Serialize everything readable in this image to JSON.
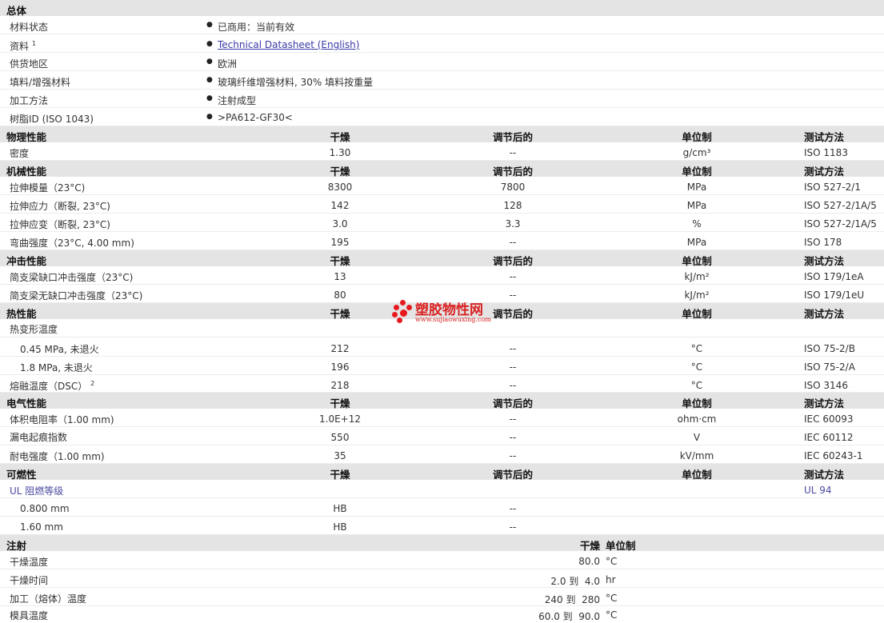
{
  "general": {
    "header": "总体",
    "rows": [
      {
        "label": "材料状态",
        "value": "已商用：当前有效"
      },
      {
        "label": "资料",
        "sup": "1",
        "value": "Technical Datasheet (English)"
      },
      {
        "label": "供货地区",
        "value": "欧洲"
      },
      {
        "label": "填料/增强材料",
        "value": "玻璃纤维增强材料, 30% 填料按重量"
      },
      {
        "label": "加工方法",
        "value": "注射成型"
      },
      {
        "label": "树脂ID (ISO 1043)",
        "value": ">PA612-GF30<"
      }
    ]
  },
  "columns": {
    "dry": "干燥",
    "conditioned": "调节后的",
    "unit": "单位制",
    "method": "测试方法"
  },
  "physical": {
    "header": "物理性能",
    "rows": [
      {
        "label": "密度",
        "dry": "1.30",
        "cond": "--",
        "unit": "g/cm³",
        "method": "ISO 1183"
      }
    ]
  },
  "mechanical": {
    "header": "机械性能",
    "rows": [
      {
        "label": "拉伸模量（23°C)",
        "dry": "8300",
        "cond": "7800",
        "unit": "MPa",
        "method": "ISO 527-2/1"
      },
      {
        "label": "拉伸应力（断裂, 23°C)",
        "dry": "142",
        "cond": "128",
        "unit": "MPa",
        "method": "ISO 527-2/1A/5"
      },
      {
        "label": "拉伸应变（断裂, 23°C)",
        "dry": "3.0",
        "cond": "3.3",
        "unit": "%",
        "method": "ISO 527-2/1A/5"
      },
      {
        "label": "弯曲强度（23°C, 4.00 mm)",
        "dry": "195",
        "cond": "--",
        "unit": "MPa",
        "method": "ISO 178"
      }
    ]
  },
  "impact": {
    "header": "冲击性能",
    "rows": [
      {
        "label": "简支梁缺口冲击强度（23°C)",
        "dry": "13",
        "cond": "--",
        "unit": "kJ/m²",
        "method": "ISO 179/1eA"
      },
      {
        "label": "简支梁无缺口冲击强度（23°C)",
        "dry": "80",
        "cond": "--",
        "unit": "kJ/m²",
        "method": "ISO 179/1eU"
      }
    ]
  },
  "thermal": {
    "header": "热性能",
    "group_label": "热变形温度",
    "rows": [
      {
        "label": "0.45 MPa, 未退火",
        "dry": "212",
        "cond": "--",
        "unit": "°C",
        "method": "ISO 75-2/B"
      },
      {
        "label": "1.8 MPa, 未退火",
        "dry": "196",
        "cond": "--",
        "unit": "°C",
        "method": "ISO 75-2/A"
      },
      {
        "label": "熔融温度（DSC）",
        "sup": "2",
        "dry": "218",
        "cond": "--",
        "unit": "°C",
        "method": "ISO 3146"
      }
    ]
  },
  "electrical": {
    "header": "电气性能",
    "rows": [
      {
        "label": "体积电阻率（1.00 mm)",
        "dry": "1.0E+12",
        "cond": "--",
        "unit": "ohm·cm",
        "method": "IEC 60093"
      },
      {
        "label": "漏电起痕指数",
        "dry": "550",
        "cond": "--",
        "unit": "V",
        "method": "IEC 60112"
      },
      {
        "label": "耐电强度（1.00 mm)",
        "dry": "35",
        "cond": "--",
        "unit": "kV/mm",
        "method": "IEC 60243-1"
      }
    ]
  },
  "flammability": {
    "header": "可燃性",
    "group_label": "UL 阻燃等级",
    "group_method": "UL 94",
    "rows": [
      {
        "label": "0.800 mm",
        "dry": "HB",
        "cond": "--"
      },
      {
        "label": "1.60 mm",
        "dry": "HB",
        "cond": "--"
      }
    ]
  },
  "injection": {
    "header": "注射",
    "dry_header": "干燥",
    "unit_header": "单位制",
    "rows": [
      {
        "label": "干燥温度",
        "value": "80.0",
        "unit": "°C"
      },
      {
        "label": "干燥时间",
        "value": "2.0 到  4.0",
        "unit": "hr"
      },
      {
        "label": "加工（熔体）温度",
        "value": "240 到  280",
        "unit": "°C"
      },
      {
        "label": "模具温度",
        "value": "60.0 到  90.0",
        "unit": "°C"
      }
    ]
  },
  "watermark": {
    "title": "塑胶物性网",
    "url": "www.sujiaowuxing.com",
    "color": "#e8191e"
  }
}
